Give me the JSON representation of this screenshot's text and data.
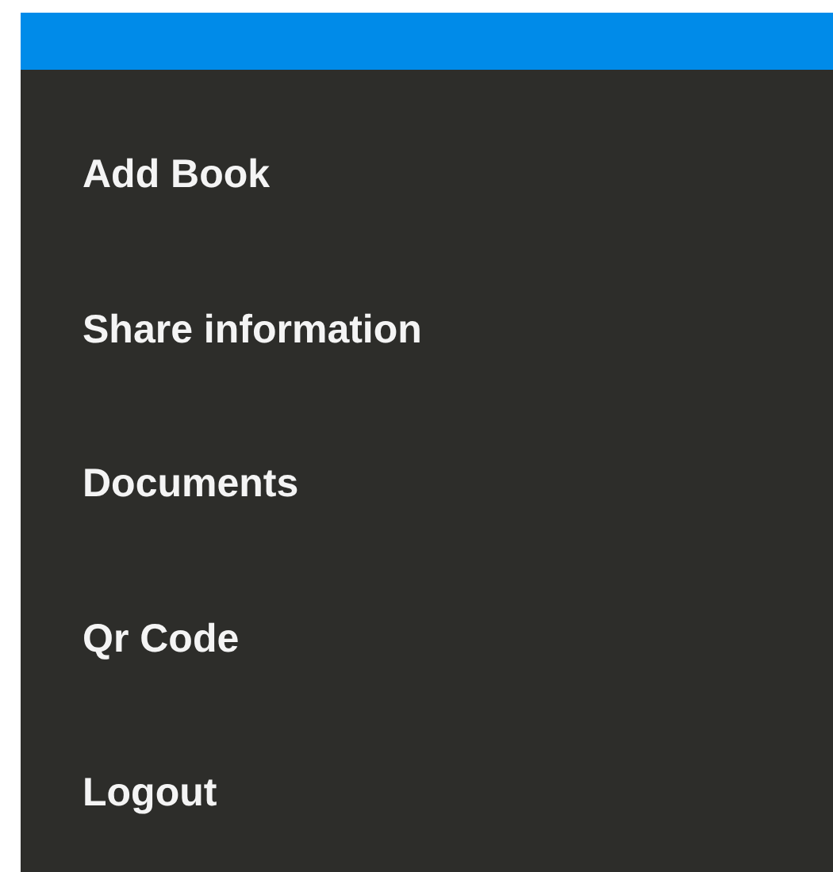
{
  "menu": {
    "items": [
      {
        "label": "Add Book"
      },
      {
        "label": "Share information"
      },
      {
        "label": "Documents"
      },
      {
        "label": "Qr Code"
      },
      {
        "label": "Logout"
      }
    ]
  }
}
